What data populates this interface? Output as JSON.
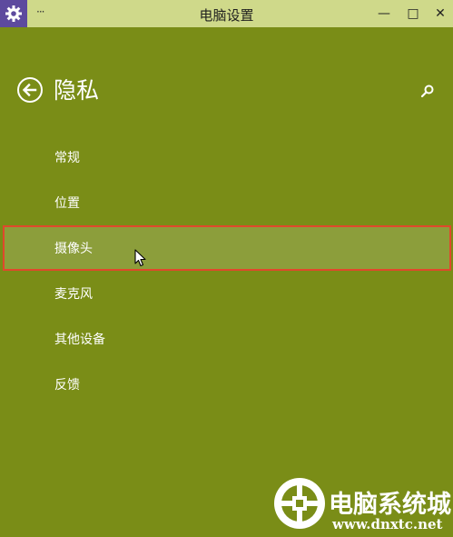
{
  "window": {
    "title": "电脑设置",
    "system_menu": "···",
    "controls": {
      "minimize": "—",
      "maximize": "□",
      "close": "✕"
    },
    "app_icon": "gear-icon"
  },
  "header": {
    "title": "隐私",
    "back_icon": "back-arrow-icon",
    "search_icon": "search-icon"
  },
  "nav": {
    "items": [
      {
        "label": "常规",
        "selected": false
      },
      {
        "label": "位置",
        "selected": false
      },
      {
        "label": "摄像头",
        "selected": true
      },
      {
        "label": "麦克风",
        "selected": false
      },
      {
        "label": "其他设备",
        "selected": false
      },
      {
        "label": "反馈",
        "selected": false
      }
    ]
  },
  "watermark": {
    "name": "电脑系统城",
    "url": "www.dnxtc.net"
  },
  "colors": {
    "accent_bg": "#7a8d17",
    "titlebar": "#cfd98a",
    "selected_bg": "#8c9e3b",
    "highlight_border": "#e0482c",
    "app_icon_bg": "#5d4a9e"
  }
}
